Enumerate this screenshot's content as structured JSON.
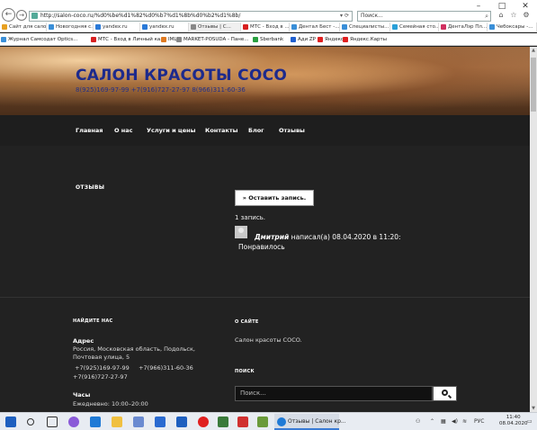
{
  "browser": {
    "url": "http://salon-coco.ru/%d0%be%d1%82%d0%b7%d1%8b%d0%b2%d1%8b/",
    "search_placeholder": "Поиск...",
    "tabs": [
      {
        "label": "Сайт для сало...",
        "color": "#e8a020"
      },
      {
        "label": "Новогодняя с...",
        "color": "#3a8fd8"
      },
      {
        "label": "yandex.ru",
        "color": "#2a7ad8"
      },
      {
        "label": "yandex.ru",
        "color": "#2a7ad8"
      },
      {
        "label": "Отзывы | С...",
        "color": "#888888"
      },
      {
        "label": "МТС - Вход в ...",
        "color": "#d82020"
      },
      {
        "label": "Дентал Бест -...",
        "color": "#3a8fd8"
      },
      {
        "label": "Специалисты...",
        "color": "#3a8fd8"
      },
      {
        "label": "Семейная сто...",
        "color": "#2aa0d8"
      },
      {
        "label": "ДентаЛэр Пл...",
        "color": "#d03060"
      },
      {
        "label": "Чебоксары -...",
        "color": "#3a8fd8"
      }
    ],
    "favorites": [
      {
        "label": "Журнал Самсодат Optics...",
        "color": "#3a8fd8"
      },
      {
        "label": "МТС - Вход в Личный ка...",
        "color": "#d82020"
      },
      {
        "label": "IML",
        "color": "#e07a20"
      },
      {
        "label": "MARKET-POSUDA - Пане...",
        "color": "#888888"
      },
      {
        "label": "Sberbank",
        "color": "#2aa040"
      },
      {
        "label": "Ади ZP",
        "color": "#2060d0"
      },
      {
        "label": "Яндекс",
        "color": "#e02020"
      },
      {
        "label": "Яндекс.Карты",
        "color": "#e02020"
      }
    ]
  },
  "site": {
    "title": "САЛОН КРАСОТЫ COCO",
    "phones": "8(925)169-97-99 +7(916)727-27-97 8(966)311-60-36",
    "nav": [
      "Главная",
      "О нас",
      "Услуги и цены",
      "Контакты",
      "Блог",
      "Отзывы"
    ]
  },
  "page": {
    "heading": "ОТЗЫВЫ",
    "write_button": "» Оставить запись.",
    "count": "1 запись.",
    "review": {
      "author": "Дмитрий",
      "meta": " написал(а) 08.04.2020 в 11:20:",
      "text": "Понравилось"
    }
  },
  "footer": {
    "find_heading": "НАЙДИТЕ НАС",
    "address_label": "Адрес",
    "address": "Россия, Московская область, Подольск, Почтовая улица, 5",
    "phones_line1": " +7(925)169-97-99     +7(966)311-60-36",
    "phones_line2": "+7(916)727-27-97",
    "hours_label": "Часы",
    "hours": "Ежедневно: 10:00–20:00",
    "about_heading": "О САЙТЕ",
    "about_text": "Салон красоты COCO.",
    "search_heading": "ПОИСК",
    "search_placeholder": "Поиск..."
  },
  "taskbar": {
    "active_label": "Отзывы | Салон кр...",
    "lang": "РУС",
    "time": "11:40",
    "date": "08.04.2020"
  }
}
